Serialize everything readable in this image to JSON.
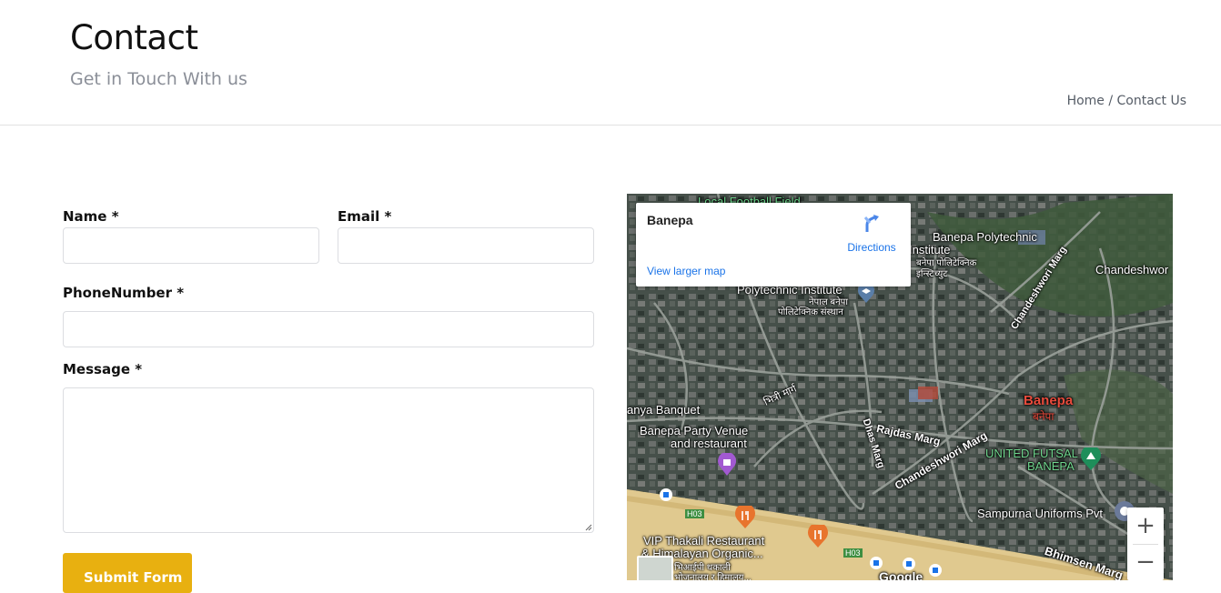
{
  "header": {
    "title": "Contact",
    "subtitle": "Get in Touch With us",
    "breadcrumb": {
      "home": "Home",
      "separator": " / ",
      "current": "Contact Us"
    }
  },
  "form": {
    "name_label": "Name *",
    "email_label": "Email *",
    "phone_label": "PhoneNumber *",
    "message_label": "Message *",
    "name_value": "",
    "email_value": "",
    "phone_value": "",
    "message_value": "",
    "submit_label": "Submit Form",
    "accent": "#e8b010"
  },
  "map": {
    "place_title": "Banepa",
    "directions_label": "Directions",
    "view_larger_label": "View larger map",
    "zoom_in": "+",
    "zoom_out": "−",
    "labels": {
      "football": "Local Football Field",
      "polytech_en": "Banepa Polytechnic",
      "polytech_en2": "Institute",
      "polytech_np": "बनेपा पोलिटेक्निक",
      "polytech_np2": "इन्स्टिच्युट",
      "polytech_inst": "Polytechnic Institute",
      "polytech_inst_np": "नेपाल बनेपा",
      "polytech_inst_np2": "पोलिटेक्निक संस्थान",
      "chandeshwor": "Chandeshwor",
      "chandeshwori_marg": "Chandeshwori Marg",
      "bhitri_marg": "भित्री मार्ग",
      "banquet": "anya Banquet",
      "party_venue": "Banepa Party Venue",
      "party_venue2": "and restaurant",
      "rajdas": "Rajdas Marg",
      "dhas": "Dhas Marg",
      "chandeshwori_marg2": "Chandeshwori Marg",
      "banepa": "Banepa",
      "banepa_np": "बनेपा",
      "futsal": "UNITED FUTSAL",
      "futsal2": "BANEPA",
      "uniforms": "Sampurna Uniforms Pvt",
      "bhimsen": "Bhimsen Marg",
      "thakali": "VIP Thakali Restaurant",
      "himalayan": "& Himalayan Organic...",
      "thakali_np": "भिआईपी थकाली",
      "thakali_np2": "भोजनालय र हिमालय...",
      "h03a": "H03",
      "h03b": "H03",
      "google": "Google"
    }
  }
}
